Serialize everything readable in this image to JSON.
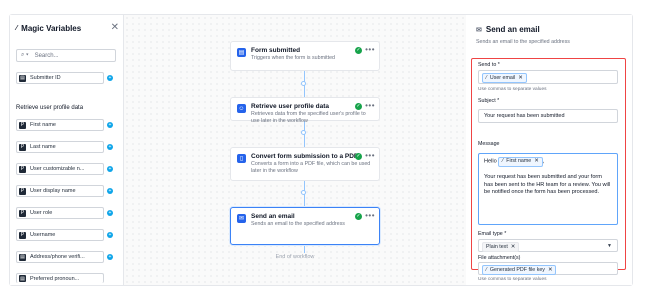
{
  "left_panel": {
    "title": "Magic Variables",
    "search_placeholder": "Search...",
    "top_item": "Submitter ID",
    "section": "Retrieve user profile data",
    "items": [
      "First name",
      "Last name",
      "User customizable n...",
      "User display name",
      "User role",
      "Username",
      "Address/phone verifi...",
      "Preferred pronoun..."
    ]
  },
  "workflow": {
    "nodes": [
      {
        "title": "Form submitted",
        "desc": "Triggers when the form is submitted"
      },
      {
        "title": "Retrieve user profile data",
        "desc": "Retrieves data from the specified user's profile to use later in the workflow"
      },
      {
        "title": "Convert form submission to a PDF",
        "desc": "Converts a form into a PDF file, which can be used later in the workflow"
      },
      {
        "title": "Send an email",
        "desc": "Sends an email to the specified address"
      }
    ],
    "end_label": "End of workflow"
  },
  "right_panel": {
    "title": "Send an email",
    "subtitle": "Sends an email to the specified address",
    "send_to_label": "Send to *",
    "send_to_chip": "User email",
    "send_to_help": "Use commas to separate values",
    "subject_label": "Subject *",
    "subject_value": "Your request has been submitted",
    "message_label": "Message",
    "message_hello": "Hello",
    "message_chip": "First name",
    "message_body": "Your request has been submitted and your form has been sent to the HR team for a review. You will be notified once the form has been processed.",
    "email_type_label": "Email type *",
    "email_type_value": "Plain text",
    "attach_label": "File attachment(s)",
    "attach_chip": "Generated PDF file key",
    "attach_help": "Use commas to separate values"
  },
  "colors": {
    "accent": "#2563eb",
    "highlight": "#ef4444",
    "success": "#16a34a",
    "plus": "#0ea5e9"
  }
}
